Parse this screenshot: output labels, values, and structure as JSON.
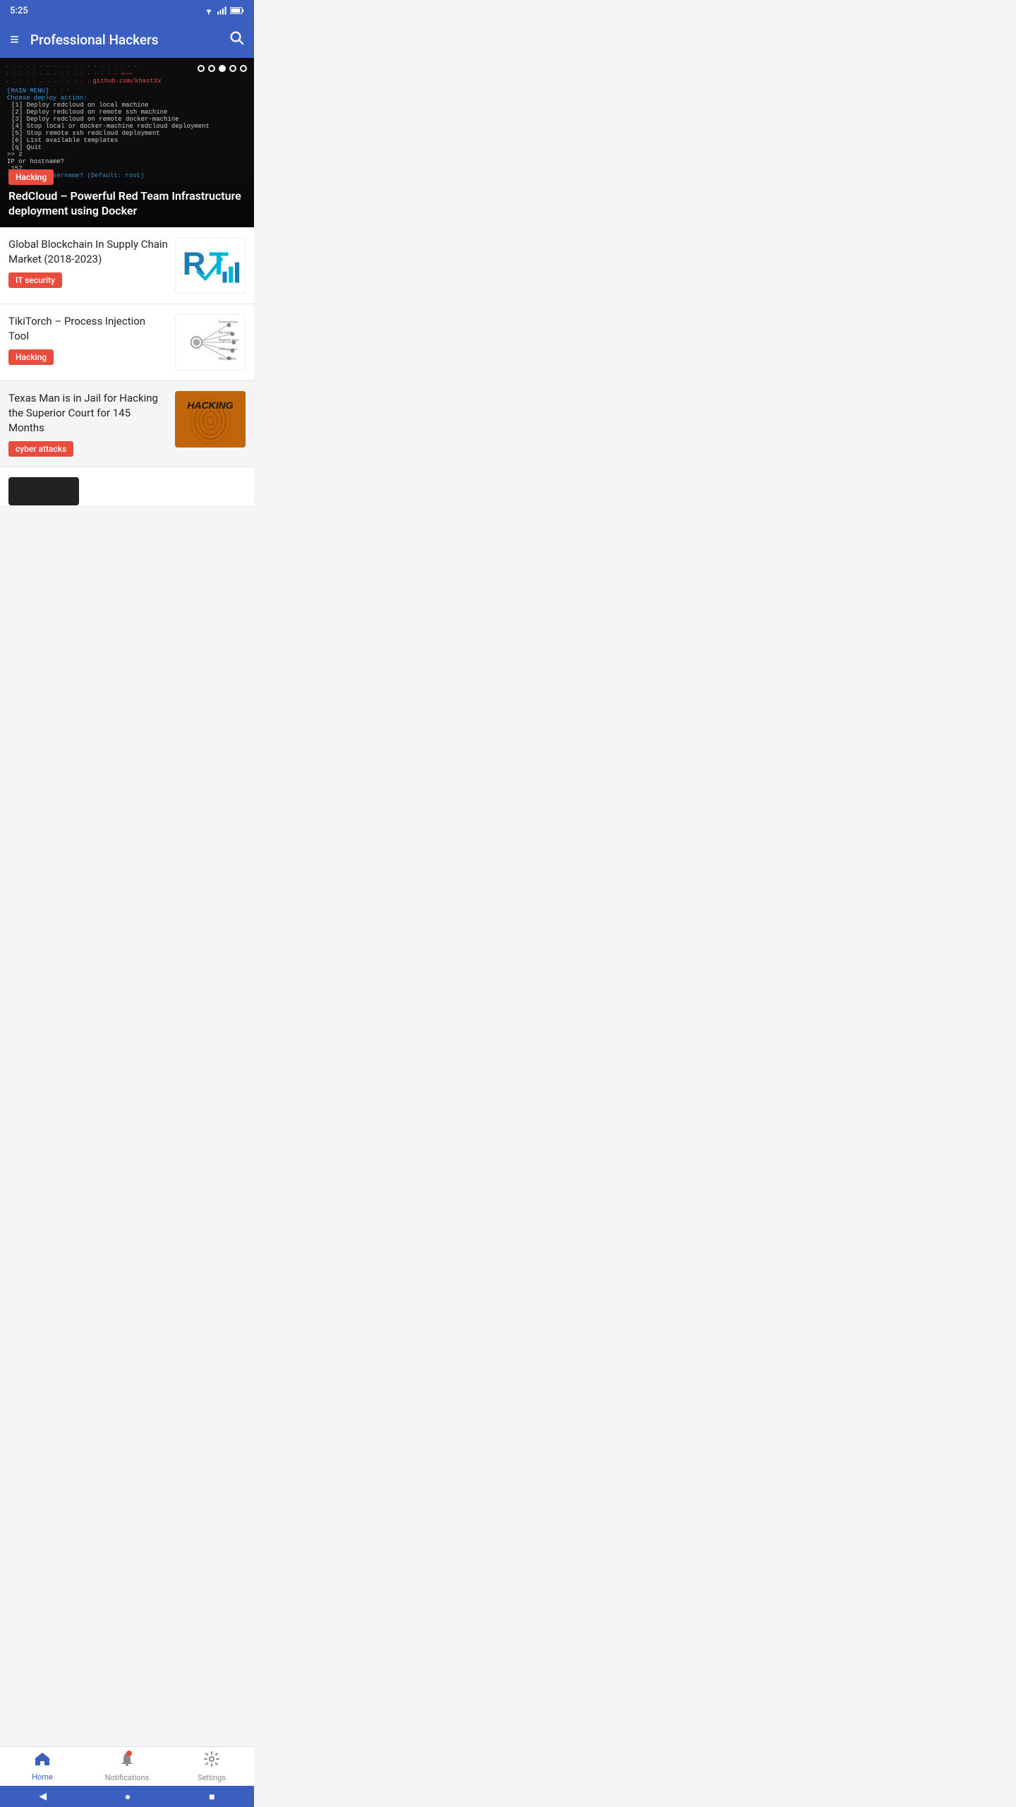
{
  "statusBar": {
    "time": "5:25",
    "wifi": "wifi",
    "signal": "signal",
    "battery": "battery"
  },
  "appBar": {
    "title": "Professional Hackers",
    "menuIcon": "≡",
    "searchIcon": "🔍"
  },
  "hero": {
    "tag": "Hacking",
    "title": "RedCloud – Powerful Red Team Infrastructure deployment using Docker",
    "terminalUrl": "github.com/khast3x",
    "terminalLines": [
      "[MAIN MENU]",
      "Choose deploy action:",
      "  [1] Deploy redcloud on local machine",
      "  [2] Deploy redcloud on remote ssh machine",
      "  [3] Deploy redcloud on remote docker-machine",
      "  [4] Stop local or docker-machine redcloud deployment",
      "  [5] Stop remote ssh redcloud deployment",
      "  [6] List available templates",
      "  [q] Quit",
      ">> 2",
      "IP or hostname?",
      ".157",
      "[?] Target username? (Default: root)"
    ],
    "dots": [
      false,
      false,
      true,
      false,
      false
    ]
  },
  "articles": [
    {
      "title": "Global Blockchain In Supply Chain Market (2018-2023)",
      "tag": "IT security",
      "tagClass": "it-security",
      "thumbType": "rt-logo"
    },
    {
      "title": "TikiTorch – Process Injection Tool",
      "tag": "Hacking",
      "tagClass": "hacking",
      "thumbType": "tikitorch"
    },
    {
      "title": "Texas Man is in Jail for Hacking the Superior Court for 145 Months",
      "tag": "cyber attacks",
      "tagClass": "cyber-attacks",
      "thumbType": "hacking-thumb"
    }
  ],
  "bottomNav": {
    "items": [
      {
        "label": "Home",
        "icon": "🏠",
        "active": true
      },
      {
        "label": "Notifications",
        "icon": "🔔",
        "active": false
      },
      {
        "label": "Settings",
        "icon": "⚙",
        "active": false
      }
    ]
  },
  "systemNav": {
    "back": "◀",
    "home": "●",
    "recent": "■"
  }
}
